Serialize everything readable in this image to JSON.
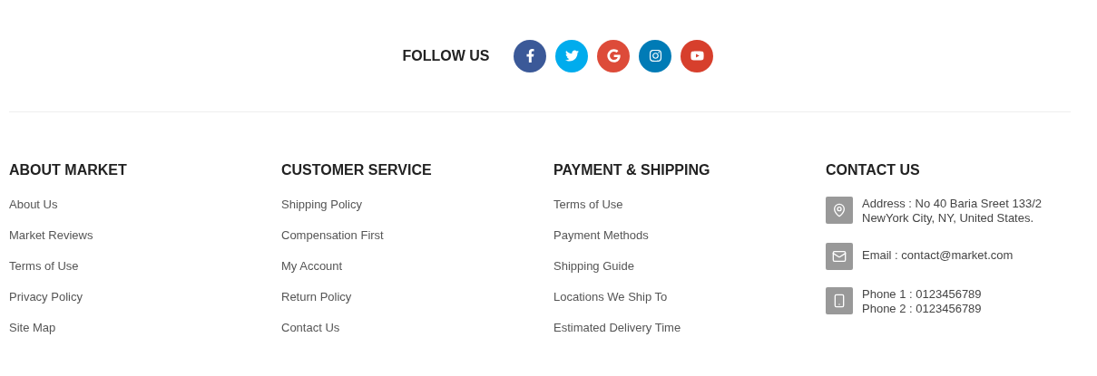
{
  "follow": {
    "title": "FOLLOW US",
    "networks": [
      {
        "kind": "facebook",
        "color": "#3b5998"
      },
      {
        "kind": "twitter",
        "color": "#00aced"
      },
      {
        "kind": "google",
        "color": "#dd4b39"
      },
      {
        "kind": "instagram",
        "color": "#007bb6"
      },
      {
        "kind": "youtube",
        "color": "#d73f2c"
      }
    ]
  },
  "columns": [
    {
      "title": "ABOUT MARKET",
      "links": [
        "About Us",
        "Market Reviews",
        "Terms of Use",
        "Privacy Policy",
        "Site Map"
      ]
    },
    {
      "title": "CUSTOMER SERVICE",
      "links": [
        "Shipping Policy",
        "Compensation First",
        "My Account",
        "Return Policy",
        "Contact Us"
      ]
    },
    {
      "title": "PAYMENT & SHIPPING",
      "links": [
        "Terms of Use",
        "Payment Methods",
        "Shipping Guide",
        "Locations We Ship To",
        "Estimated Delivery Time"
      ]
    }
  ],
  "contact": {
    "title": "CONTACT US",
    "items": [
      {
        "kind": "address",
        "lines": [
          "Address : No 40 Baria Sreet 133/2",
          "NewYork City, NY, United States."
        ]
      },
      {
        "kind": "email",
        "lines": [
          "Email : contact@market.com"
        ]
      },
      {
        "kind": "phone",
        "lines": [
          "Phone 1 : 0123456789",
          "Phone 2 : 0123456789"
        ]
      }
    ]
  }
}
